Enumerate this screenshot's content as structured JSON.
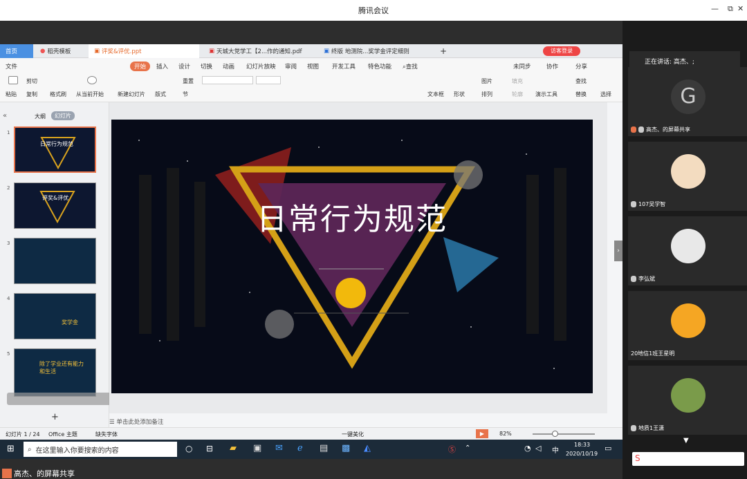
{
  "meeting_window": {
    "title": "腾讯会议",
    "minimize": "—",
    "restore": "⧉",
    "close": "✕"
  },
  "wps": {
    "tabs": [
      {
        "label": "首页"
      },
      {
        "label": "稻壳模板"
      },
      {
        "label": "评奖&评优.ppt"
      },
      {
        "label": "天城大党学工【2...作的通知.pdf"
      },
      {
        "label": "终版  地测院...奖学金评定细则"
      }
    ],
    "add_tab": "+",
    "login_badge": "访客登录",
    "menu": [
      "文件",
      "开始",
      "插入",
      "设计",
      "切换",
      "动画",
      "幻灯片放映",
      "审阅",
      "视图",
      "开发工具",
      "特色功能"
    ],
    "search_label": "查找",
    "menu_right": [
      "未同步",
      "协作",
      "分享"
    ],
    "ribbon": {
      "paste": "粘贴",
      "cut": "剪切",
      "copy": "复制",
      "format_painter": "格式刷",
      "play_from_current": "从当前开始",
      "new_slide": "新建幻灯片",
      "layout": "版式",
      "section": "节",
      "reset": "重置",
      "textbox": "文本框",
      "shape": "形状",
      "picture": "图片",
      "arrange": "排列",
      "fill": "填充",
      "outline": "轮廓",
      "presenter_tools": "演示工具",
      "find": "查找",
      "replace": "替换",
      "select": "选择"
    },
    "left_tabs": [
      "大纲",
      "幻灯片"
    ],
    "thumbs": [
      {
        "num": "1",
        "title": "日常行为规范"
      },
      {
        "num": "2",
        "title": "评奖&评优"
      },
      {
        "num": "3",
        "title": ""
      },
      {
        "num": "4",
        "title": "奖学金"
      },
      {
        "num": "5",
        "title": "除了学业还有能力和生活"
      }
    ],
    "slide_title": "日常行为规范",
    "notes_placeholder": "单击此处添加备注",
    "status": {
      "slide_count": "幻灯片 1 / 24",
      "theme": "Office 主题",
      "font_missing": "缺失字体",
      "beautify": "一键美化",
      "zoom": "82%"
    }
  },
  "taskbar": {
    "search_placeholder": "在这里输入你要搜索的内容",
    "time": "18:33",
    "date": "2020/10/19",
    "ime": "中"
  },
  "share_label": "高杰、的屏幕共享",
  "participants": {
    "speaking": "正在讲话: 高杰、;",
    "list": [
      {
        "name": "高杰、的屏幕共享",
        "avatar_letter": "G",
        "color": "#3a3a3a"
      },
      {
        "name": "107吴学智",
        "avatar_letter": "",
        "color": "#f3dcc0"
      },
      {
        "name": "李弘斌",
        "avatar_letter": "",
        "color": "#e8e8e8"
      },
      {
        "name": "20地信1班王星明",
        "avatar_letter": "",
        "color": "#f5a623"
      },
      {
        "name": "地质1王潇",
        "avatar_letter": "",
        "color": "#7a9b4a"
      }
    ]
  }
}
